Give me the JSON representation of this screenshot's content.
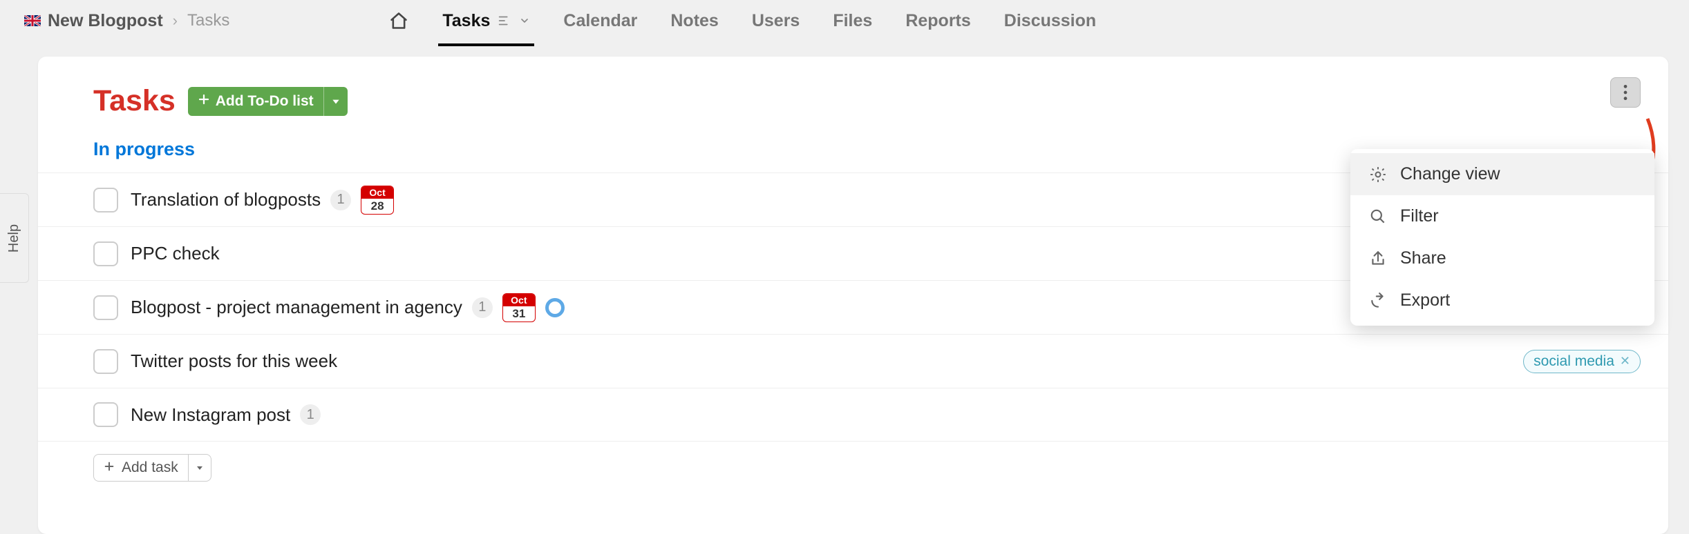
{
  "breadcrumb": {
    "project": "New Blogpost",
    "current": "Tasks"
  },
  "nav": {
    "tasks": "Tasks",
    "calendar": "Calendar",
    "notes": "Notes",
    "users": "Users",
    "files": "Files",
    "reports": "Reports",
    "discussion": "Discussion"
  },
  "help_label": "Help",
  "page": {
    "title": "Tasks",
    "add_list_label": "Add To-Do list",
    "list_title": "In progress",
    "add_task_label": "Add task"
  },
  "tasks": [
    {
      "title": "Translation of blogposts",
      "count": "1",
      "date_month": "Oct",
      "date_day": "28"
    },
    {
      "title": "PPC check"
    },
    {
      "title": "Blogpost - project management in agency",
      "count": "1",
      "date_month": "Oct",
      "date_day": "31",
      "ring": true
    },
    {
      "title": "Twitter posts for this week",
      "tag": "social media"
    },
    {
      "title": "New Instagram post",
      "count": "1"
    }
  ],
  "menu": {
    "change_view": "Change view",
    "filter": "Filter",
    "share": "Share",
    "export": "Export"
  }
}
